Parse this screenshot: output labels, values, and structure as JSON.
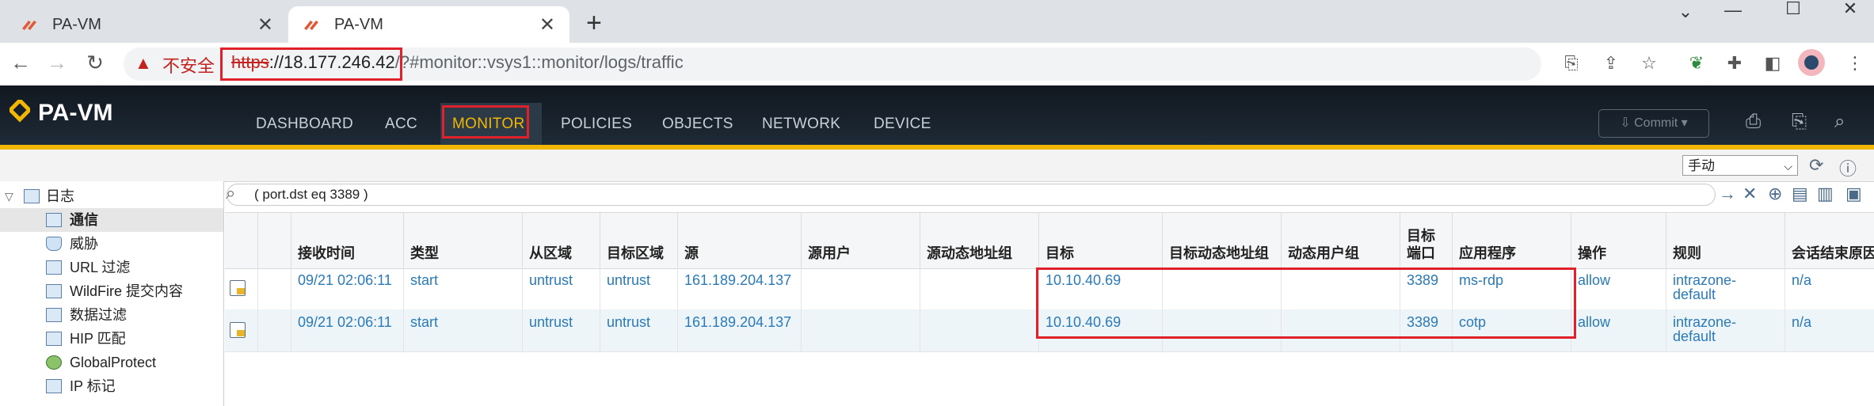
{
  "browser": {
    "tabs": [
      {
        "title": "PA-VM"
      },
      {
        "title": "PA-VM"
      }
    ],
    "new_tab": "+",
    "window": {
      "minimize": "⌄",
      "restore": "—",
      "maximize": "☐",
      "close": "✕"
    },
    "security_label": "不安全",
    "url_scheme": "https",
    "url_host": "://18.177.246.42",
    "url_rest": "/?#monitor::vsys1::monitor/logs/traffic"
  },
  "app": {
    "logo_text": "PA-VM",
    "nav": [
      "DASHBOARD",
      "ACC",
      "MONITOR",
      "POLICIES",
      "OBJECTS",
      "NETWORK",
      "DEVICE"
    ],
    "active_nav": "MONITOR",
    "commit_label": "Commit",
    "refresh_mode": "手动"
  },
  "sidebar": {
    "root": "日志",
    "items": [
      "通信",
      "威胁",
      "URL 过滤",
      "WildFire 提交内容",
      "数据过滤",
      "HIP 匹配",
      "GlobalProtect",
      "IP 标记"
    ],
    "selected": "通信"
  },
  "filter": {
    "query": "( port.dst eq 3389 )"
  },
  "table": {
    "columns": [
      "",
      "",
      "接收时间",
      "类型",
      "从区域",
      "目标区域",
      "源",
      "源用户",
      "源动态地址组",
      "目标",
      "目标动态地址组",
      "动态用户组",
      "目标\n端口",
      "应用程序",
      "操作",
      "规则",
      "会话结束原因"
    ],
    "rows": [
      {
        "time": "09/21 02:06:11",
        "type": "start",
        "from_zone": "untrust",
        "to_zone": "untrust",
        "source": "161.189.204.137",
        "src_user": "",
        "src_dag": "",
        "dest": "10.10.40.69",
        "dst_dag": "",
        "dug": "",
        "port": "3389",
        "app": "ms-rdp",
        "action": "allow",
        "rule": "intrazone-\ndefault",
        "end_reason": "n/a"
      },
      {
        "time": "09/21 02:06:11",
        "type": "start",
        "from_zone": "untrust",
        "to_zone": "untrust",
        "source": "161.189.204.137",
        "src_user": "",
        "src_dag": "",
        "dest": "10.10.40.69",
        "dst_dag": "",
        "dug": "",
        "port": "3389",
        "app": "cotp",
        "action": "allow",
        "rule": "intrazone-\ndefault",
        "end_reason": "n/a"
      }
    ]
  },
  "colors": {
    "accent": "#f2b705",
    "highlight": "#e0202b",
    "link": "#2a7ab8"
  }
}
